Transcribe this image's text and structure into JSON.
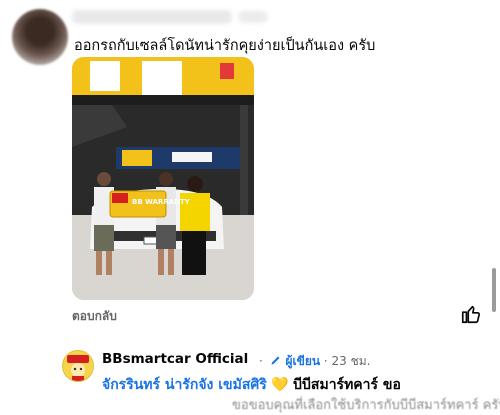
{
  "comment": {
    "text": "ออกรถกับเซลล์โดนัทน่ารักคุยง่ายเป็นกันเอง ครับ",
    "reply_action": "ตอบกลับ"
  },
  "photo": {
    "sign_text": "BB WARRANTY"
  },
  "reply": {
    "author": "BBsmartcar Official",
    "dot": "·",
    "author_badge": "ผู้เขียน",
    "time": "23 ชม.",
    "mention": "จักรรินทร์ น่ารักจัง เขมัสศิริ",
    "heart": "💛",
    "text_start": "บีบีสมาร์ทคาร์ ขอ",
    "text_cont": "ขอขอบคุณที่เลือกใช้บริการกับบีบีสมาร์ทคาร์ ครับ"
  },
  "colors": {
    "link_blue": "#1b74e4",
    "meta_gray": "#65676b",
    "brand_yellow": "#f5c518"
  }
}
